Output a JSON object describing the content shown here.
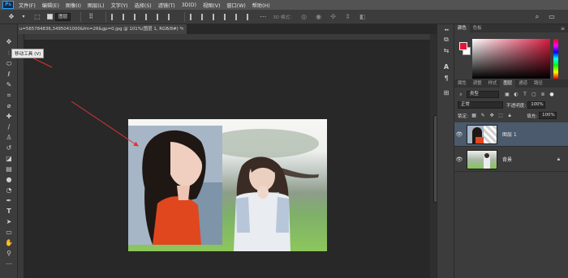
{
  "menu": {
    "items": [
      "文件(F)",
      "编辑(E)",
      "图像(I)",
      "图层(L)",
      "文字(Y)",
      "选择(S)",
      "滤镜(T)",
      "3D(D)",
      "视图(V)",
      "窗口(W)",
      "帮助(H)"
    ]
  },
  "options_bar": {
    "auto_select_target": "图层",
    "mode_3d_label": "3D 模式："
  },
  "document": {
    "tab_title": "u=565784836,3495041000&fm=26&gp=0.jpg @ 101%(图层 1, RGB/8#) *"
  },
  "tooltip": {
    "text": "移动工具 (V)"
  },
  "panels": {
    "color_tabs": [
      "颜色",
      "色板"
    ],
    "layers_tabs": [
      "属性",
      "调整",
      "样式",
      "图层",
      "通道",
      "路径"
    ],
    "kind_filter": "类型",
    "blend_mode": "正常",
    "opacity_label": "不透明度:",
    "opacity_value": "100%",
    "lock_label": "锁定:",
    "fill_label": "填充:",
    "fill_value": "100%",
    "layers": [
      {
        "name": "图层 1",
        "visible": true,
        "selected": true
      },
      {
        "name": "背景",
        "visible": true,
        "locked": true
      }
    ]
  },
  "colors": {
    "foreground": "#e2143a",
    "background": "#ffffff",
    "selected_layer_row": "#4b5a6c",
    "annotation_arrow": "#e03030"
  }
}
